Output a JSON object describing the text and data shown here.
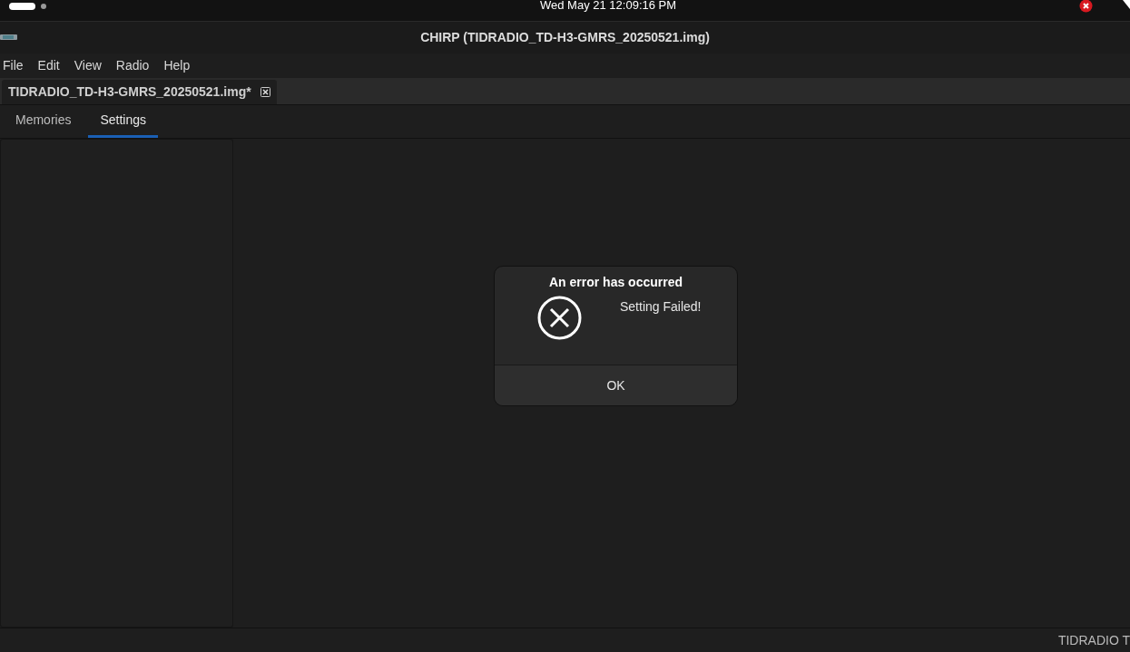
{
  "top_bar": {
    "clock": "Wed May 21  12:09:16 PM"
  },
  "window": {
    "title": "CHIRP (TIDRADIO_TD-H3-GMRS_20250521.img)"
  },
  "menu": [
    "File",
    "Edit",
    "View",
    "Radio",
    "Help"
  ],
  "file_tab": {
    "label": "TIDRADIO_TD-H3-GMRS_20250521.img*"
  },
  "tabs": [
    {
      "label": "Memories",
      "selected": false
    },
    {
      "label": "Settings",
      "selected": true
    }
  ],
  "dialog": {
    "title": "An error has occurred",
    "message": "Setting Failed!",
    "button": "OK"
  },
  "status_bar": {
    "text": "TIDRADIO T"
  }
}
